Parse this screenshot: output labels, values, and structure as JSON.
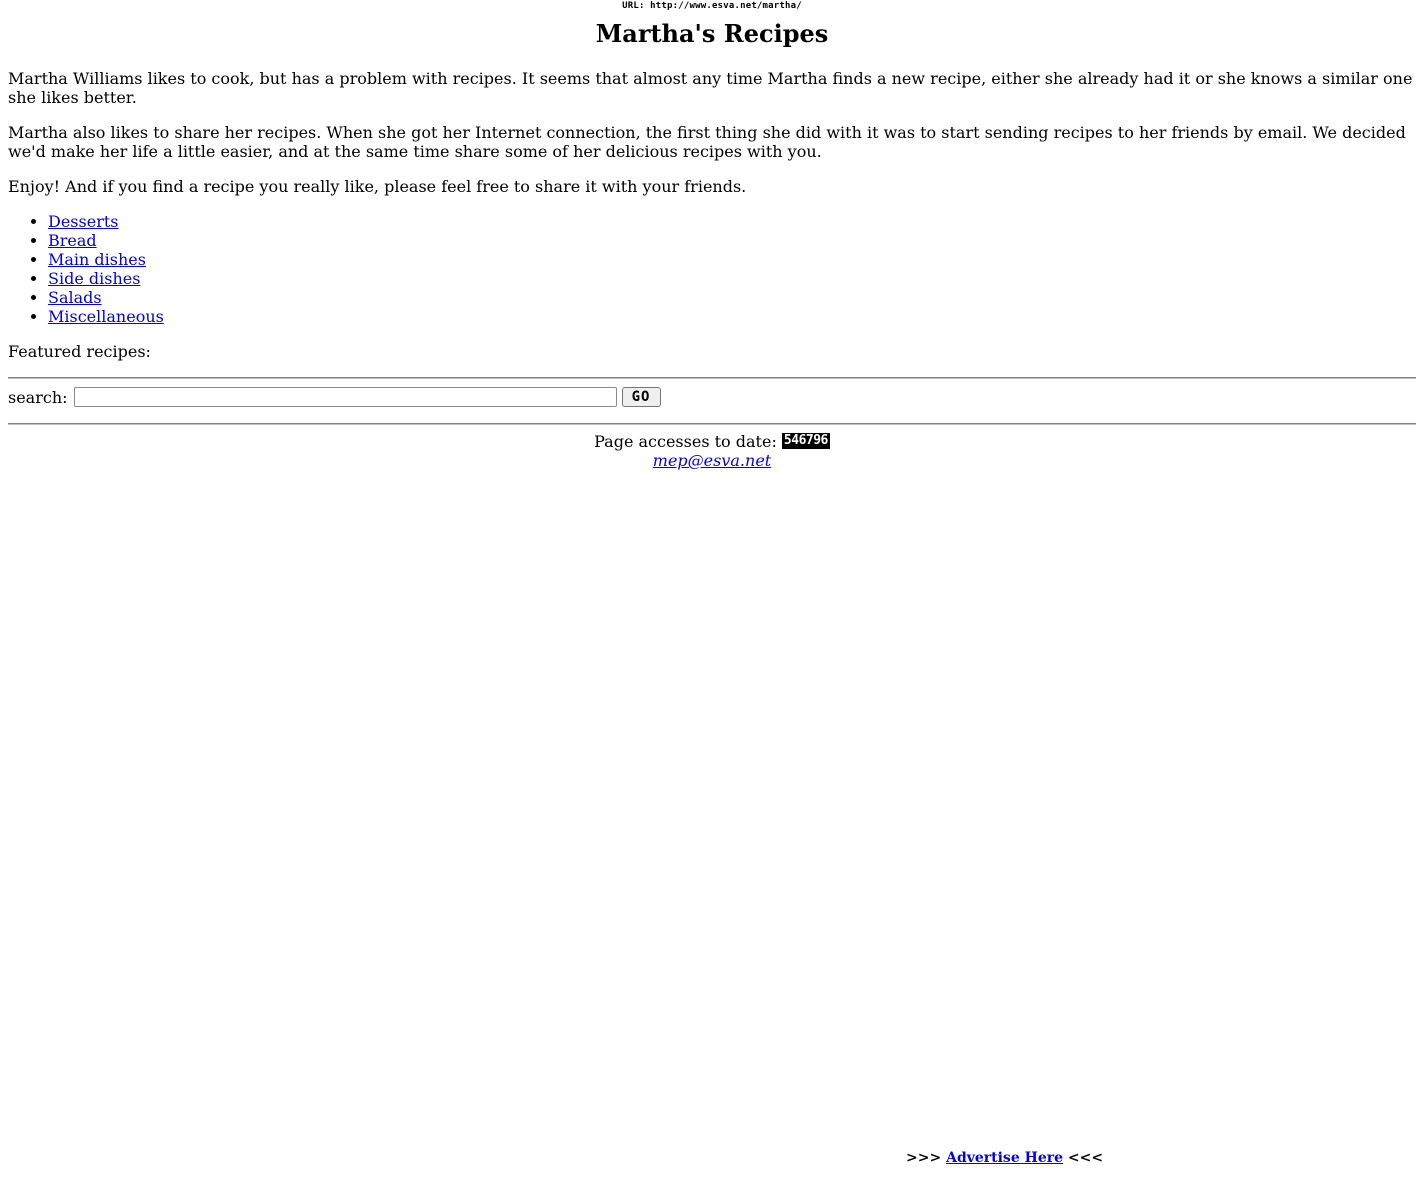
{
  "url_banner": "URL: http://www.esva.net/martha/",
  "title": "Martha's Recipes",
  "paragraphs": [
    "Martha Williams likes to cook, but has a problem with recipes. It seems that almost any time Martha finds a new recipe, either she already had it or she knows a similar one she likes better.",
    "Martha also likes to share her recipes. When she got her Internet connection, the first thing she did with it was to start sending recipes to her friends by email. We decided we'd make her life a little easier, and at the same time share some of her delicious recipes with you.",
    "Enjoy! And if you find a recipe you really like, please feel free to share it with your friends."
  ],
  "categories": [
    {
      "label": "Desserts"
    },
    {
      "label": "Bread"
    },
    {
      "label": "Main dishes"
    },
    {
      "label": "Side dishes"
    },
    {
      "label": "Salads"
    },
    {
      "label": "Miscellaneous"
    }
  ],
  "featured_label": "Featured recipes:",
  "search": {
    "label": "search:",
    "value": "",
    "button_label": "GO"
  },
  "footer": {
    "accesses_label": "Page accesses to date:",
    "counter": "546796",
    "email": "mep@esva.net"
  },
  "advertise": {
    "prefix": ">>>",
    "link_label": "Advertise Here",
    "suffix": "<<<"
  },
  "colors": {
    "link": "#0000ee",
    "background": "#ffffff",
    "text": "#000000"
  }
}
